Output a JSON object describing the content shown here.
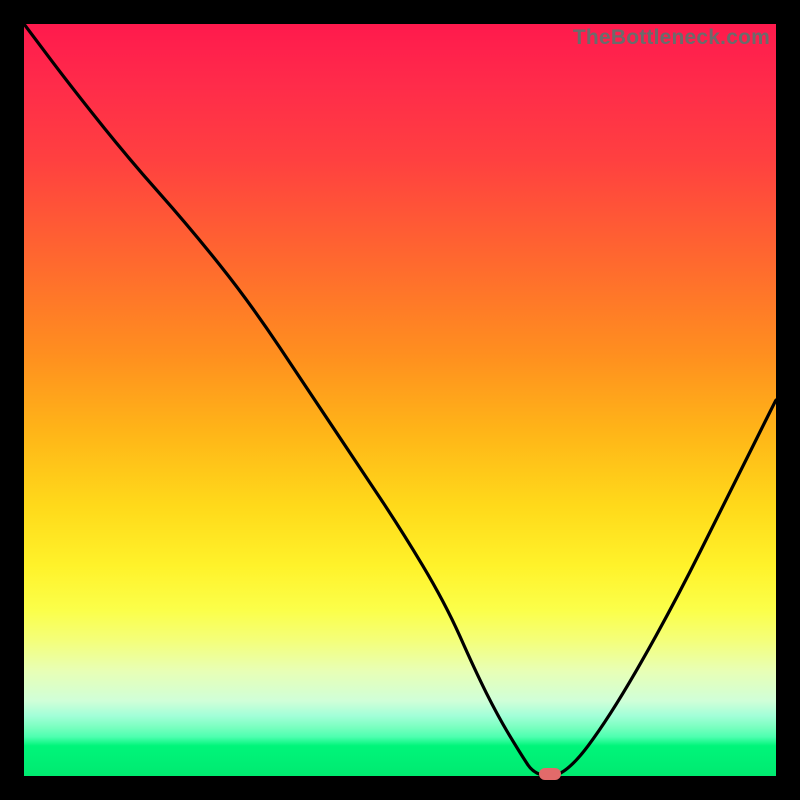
{
  "watermark": "TheBottleneck.com",
  "colors": {
    "frame": "#000000",
    "curve": "#000000",
    "marker": "#e26a6a"
  },
  "chart_data": {
    "type": "line",
    "title": "",
    "xlabel": "",
    "ylabel": "",
    "xlim": [
      0,
      100
    ],
    "ylim": [
      0,
      100
    ],
    "grid": false,
    "legend": false,
    "background": "power-gradient-red-to-green",
    "series": [
      {
        "name": "bottleneck-curve",
        "x": [
          0,
          6,
          14,
          22,
          30,
          38,
          44,
          50,
          56,
          60,
          63,
          66,
          68,
          72,
          78,
          86,
          94,
          100
        ],
        "y": [
          100,
          92,
          82,
          73,
          63,
          51,
          42,
          33,
          23,
          14,
          8,
          3,
          0,
          0,
          8,
          22,
          38,
          50
        ]
      }
    ],
    "marker": {
      "x": 70,
      "y": 0
    },
    "notes": "y=0 is the bottom green band (optimal); y=100 is the top red band (worst)."
  }
}
